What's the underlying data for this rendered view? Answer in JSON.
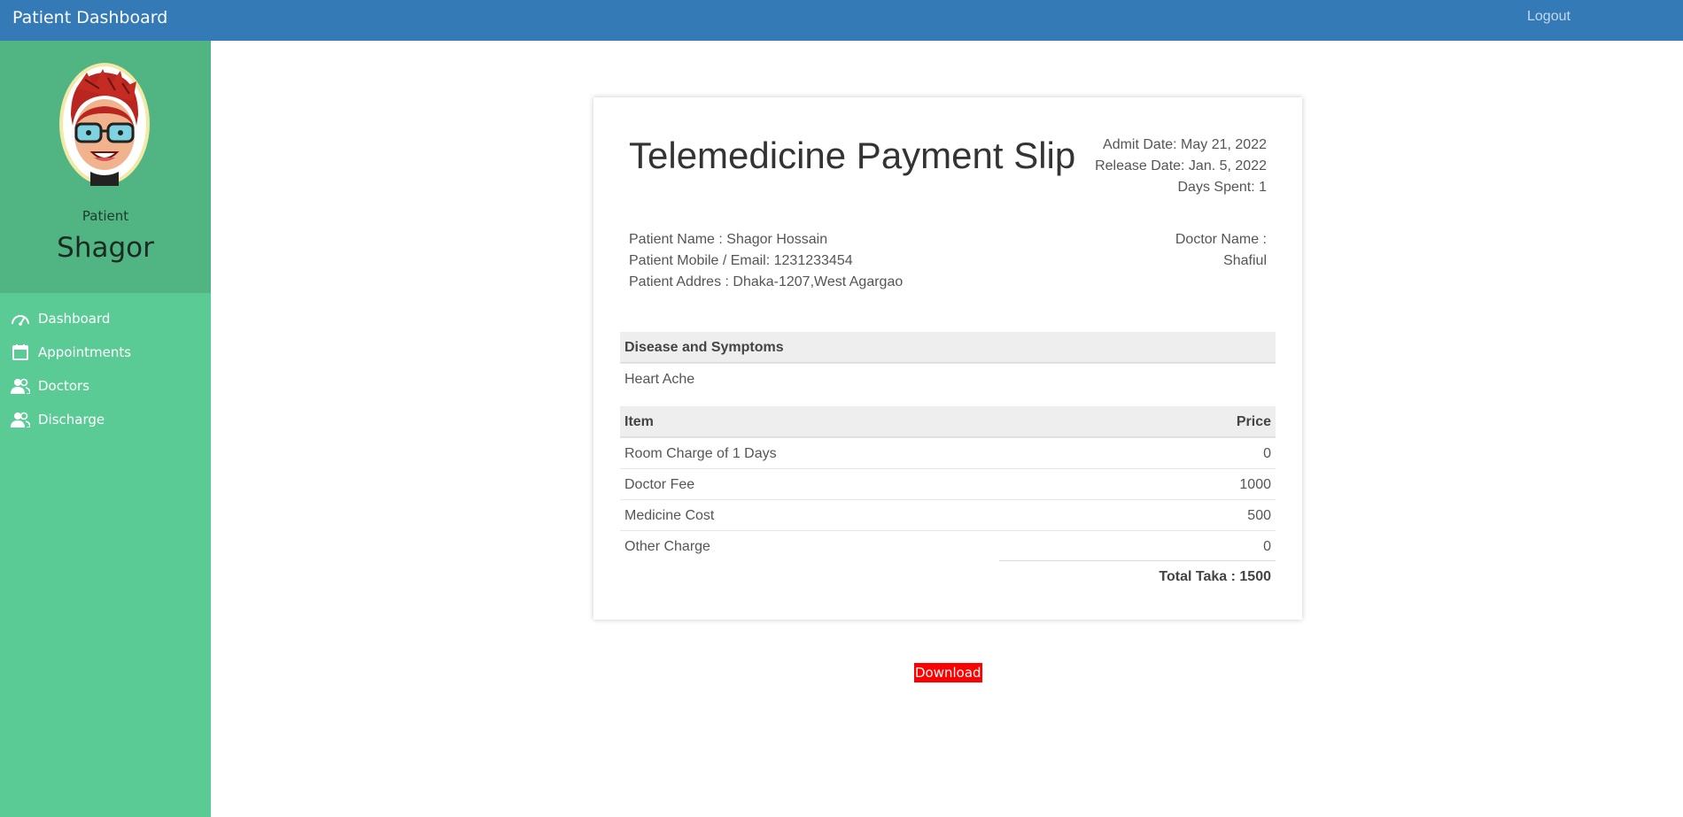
{
  "header": {
    "brand": "Patient Dashboard",
    "logout_label": "Logout"
  },
  "sidebar": {
    "role": "Patient",
    "name": "Shagor",
    "items": [
      {
        "label": "Dashboard",
        "icon": "speedometer-icon"
      },
      {
        "label": "Appointments",
        "icon": "calendar-icon"
      },
      {
        "label": "Doctors",
        "icon": "users-icon"
      },
      {
        "label": "Discharge",
        "icon": "users-icon"
      }
    ]
  },
  "slip": {
    "title": "Telemedicine Payment Slip",
    "admit_date": "Admit Date: May 21, 2022",
    "release_date": "Release Date: Jan. 5, 2022",
    "days_spent": "Days Spent: 1",
    "patient_name": "Patient Name : Shagor Hossain",
    "patient_contact": "Patient Mobile / Email: 1231233454",
    "patient_address": "Patient Addres : Dhaka-1207,West Agargao",
    "doctor_label": "Doctor Name :",
    "doctor_name": "Shafiul",
    "disease_header": "Disease and Symptoms",
    "disease_value": "Heart Ache",
    "items_header": {
      "item": "Item",
      "price": "Price"
    },
    "items": [
      {
        "item": "Room Charge of 1 Days",
        "price": "0"
      },
      {
        "item": "Doctor Fee",
        "price": "1000"
      },
      {
        "item": "Medicine Cost",
        "price": "500"
      },
      {
        "item": "Other Charge",
        "price": "0"
      }
    ],
    "total": "Total Taka : 1500"
  },
  "download_label": "Download",
  "colors": {
    "topbar": "#337ab7",
    "sidebar": "#5bcb96",
    "profile": "#50b582",
    "download": "#ff0000"
  }
}
